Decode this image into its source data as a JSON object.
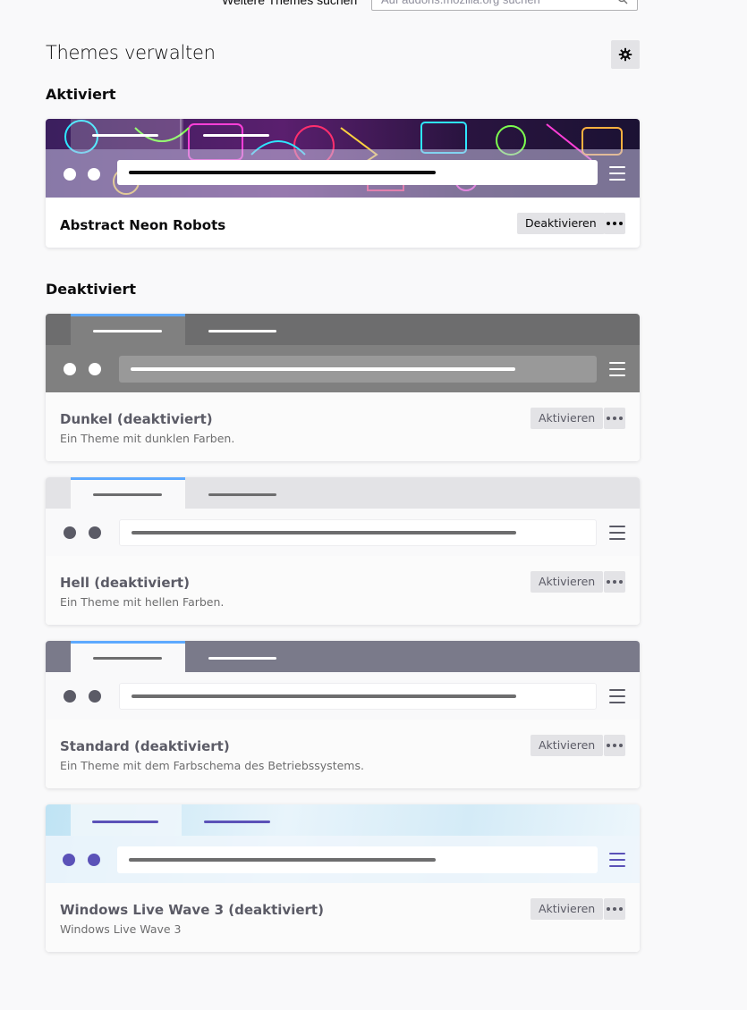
{
  "search": {
    "label": "Weitere Themes suchen",
    "placeholder": "Auf addons.mozilla.org suchen"
  },
  "page": {
    "title": "Themes verwalten",
    "gear_icon": "gear-icon"
  },
  "sections": {
    "enabled_heading": "Aktiviert",
    "disabled_heading": "Deaktiviert"
  },
  "enabled_theme": {
    "name": "Abstract Neon Robots",
    "action": "Deaktivieren"
  },
  "disabled_themes": [
    {
      "name": "Dunkel (deaktiviert)",
      "description": "Ein Theme mit dunklen Farben.",
      "action": "Aktivieren",
      "colors": {
        "frame": "#6d6d6e",
        "tab": "#808080",
        "tab_line": "#5da9ff",
        "text": "#ffffff",
        "toolbar": "#808080",
        "urlbar": "#999999",
        "url_line": "#ffffff",
        "dot": "#ffffff"
      }
    },
    {
      "name": "Hell (deaktiviert)",
      "description": "Ein Theme mit hellen Farben.",
      "action": "Aktivieren",
      "colors": {
        "frame": "#e3e3e6",
        "tab": "#f9f9fa",
        "tab_line": "#5da9ff",
        "text": "#6d6d6e",
        "toolbar": "#f9f9fa",
        "urlbar": "#ffffff",
        "url_line": "#6d6d6e",
        "dot": "#5b5b66"
      }
    },
    {
      "name": "Standard (deaktiviert)",
      "description": "Ein Theme mit dem Farbschema des Betriebssystems.",
      "action": "Aktivieren",
      "colors": {
        "frame": "#7a7a8a",
        "tab": "#f9f9fa",
        "tab_line": "#5da9ff",
        "text": "#6d6d6e",
        "toolbar": "#f9f9fa",
        "urlbar": "#ffffff",
        "url_line": "#6d6d6e",
        "dot": "#5b5b66"
      }
    },
    {
      "name": "Windows Live Wave 3 (deaktiviert)",
      "description": "Windows Live Wave 3",
      "action": "Aktivieren",
      "colors": {
        "frame": "#d6ecf6",
        "tab": "#eef6fb",
        "tab_line": "#5b52b8",
        "text": "#5b52b8",
        "toolbar": "#eef6fb",
        "urlbar": "#ffffff",
        "url_line": "#6d6d6e",
        "dot": "#5b52b8"
      }
    }
  ]
}
